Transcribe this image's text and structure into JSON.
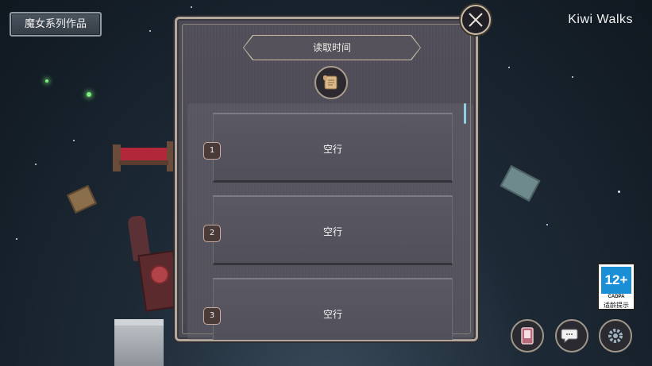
{
  "header": {
    "series_button_label": "魔女系列作品",
    "brand": "Kiwi Walks"
  },
  "dialog": {
    "title": "读取时间",
    "slots": [
      {
        "number": "1",
        "label": "空行"
      },
      {
        "number": "2",
        "label": "空行"
      },
      {
        "number": "3",
        "label": "空行"
      }
    ]
  },
  "age_rating": {
    "rating": "12+",
    "org": "CADPA",
    "tip": "适龄提示"
  },
  "icons": {
    "close": "close-icon",
    "scroll": "scroll-icon",
    "phone": "phone-icon",
    "chat": "chat-icon",
    "settings": "gear-icon"
  },
  "colors": {
    "panel": "#4b4a55",
    "panel_border": "#b3a89b",
    "slot_number_border": "#c9a9a0",
    "rating_blue": "#1a8fd6"
  }
}
